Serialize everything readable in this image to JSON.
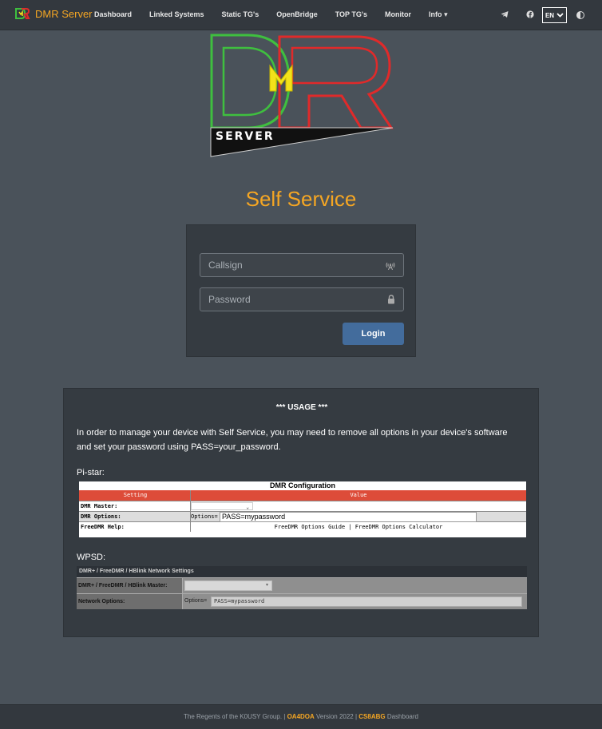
{
  "navbar": {
    "brand": "DMR Server",
    "links": [
      "Dashboard",
      "Linked Systems",
      "Static TG's",
      "OpenBridge",
      "TOP TG's",
      "Monitor",
      "Info"
    ],
    "info_caret": "▾",
    "lang": "EN",
    "icons": [
      "telegram-icon",
      "facebook-icon",
      "contrast-icon"
    ]
  },
  "logo": {
    "letters": "DMR",
    "caption": "SERVER",
    "colors": {
      "green": "#3fbf3f",
      "yellow": "#f2e21a",
      "red": "#e02a2a"
    }
  },
  "page": {
    "title": "Self Service"
  },
  "login": {
    "callsign_placeholder": "Callsign",
    "password_placeholder": "Password",
    "button": "Login"
  },
  "usage": {
    "title": "*** USAGE ***",
    "text": "In order to manage your device with Self Service, you may need to remove all options in your device's software and set your password using PASS=your_password.",
    "pistar_label": "Pi-star:",
    "pistar": {
      "title": "DMR Configuration",
      "headers": [
        "Setting",
        "Value"
      ],
      "rows": {
        "master": "DMR Master:",
        "options": "DMR Options:",
        "options_prefix": "Options=",
        "options_value": "PASS=mypassword",
        "help": "FreeDMR Help:",
        "help_value": "FreeDMR Options Guide | FreeDMR Options Calculator"
      }
    },
    "wpsd_label": "WPSD:",
    "wpsd": {
      "title": "DMR+ / FreeDMR / HBlink Network Settings",
      "master": "DMR+ / FreeDMR / HBlink Master:",
      "options": "Network Options:",
      "options_prefix": "Options=",
      "options_value": "PASS=mypassword"
    }
  },
  "footer": {
    "prefix": "The Regents of the K0USY Group. | ",
    "author": "OA4DOA",
    "middle": " Version 2022 | ",
    "author2": "CS8ABG",
    "suffix": " Dashboard"
  },
  "colors": {
    "accent": "#f5a623",
    "login_button": "#436c9c",
    "background": "#4a525a"
  }
}
